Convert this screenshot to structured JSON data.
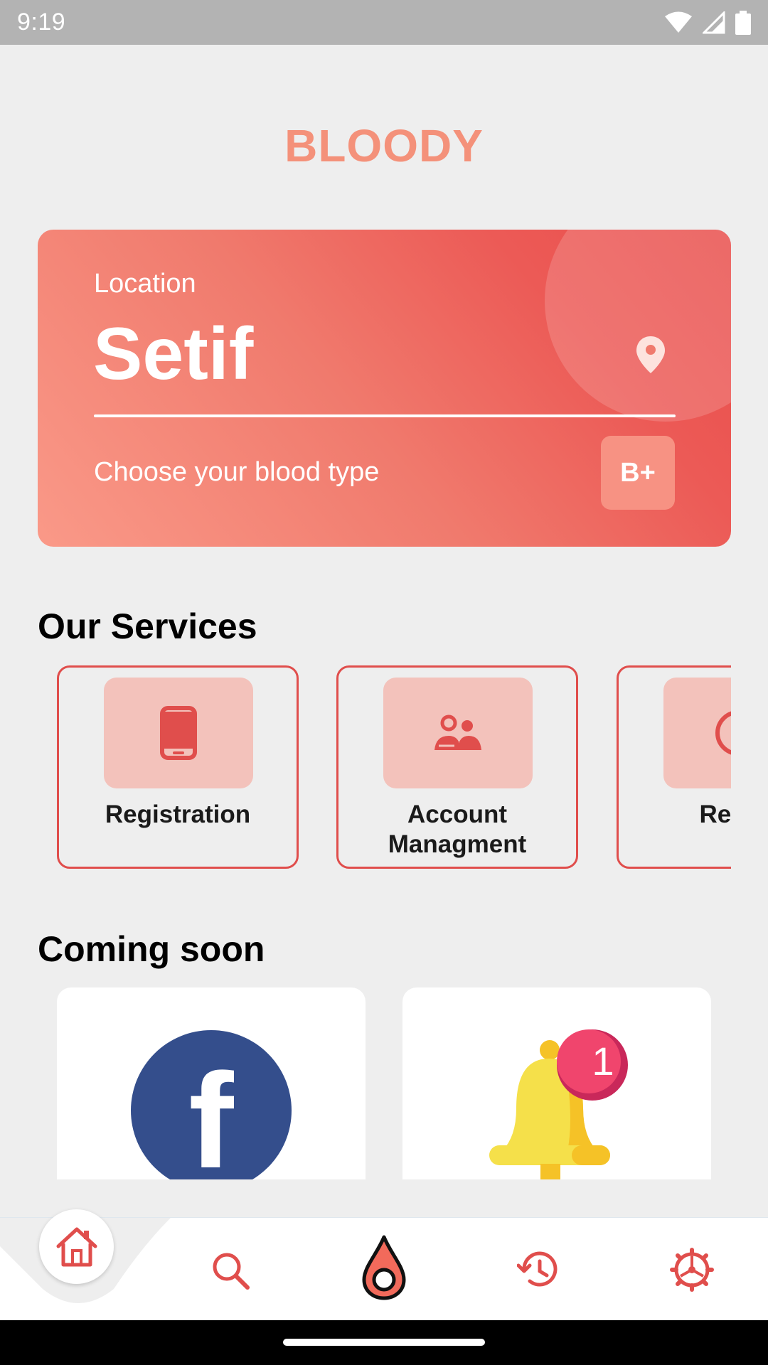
{
  "status_bar": {
    "time": "9:19"
  },
  "app": {
    "title": "BLOODY"
  },
  "location_card": {
    "label": "Location",
    "value": "Setif",
    "blood_type_prompt": "Choose your blood type",
    "blood_type": "B+"
  },
  "services": {
    "title": "Our Services",
    "items": [
      {
        "label": "Registration",
        "icon": "phone-icon"
      },
      {
        "label": "Account Managment",
        "icon": "users-icon"
      },
      {
        "label": "Rende",
        "icon": "clock-icon"
      }
    ]
  },
  "coming_soon": {
    "title": "Coming soon",
    "items": [
      {
        "icon": "facebook-icon",
        "letter": "f"
      },
      {
        "icon": "bell-notification-icon",
        "badge": "1"
      }
    ]
  },
  "bottom_nav": {
    "items": [
      {
        "icon": "home-icon",
        "active": true
      },
      {
        "icon": "search-icon"
      },
      {
        "icon": "blood-drop-icon"
      },
      {
        "icon": "history-icon"
      },
      {
        "icon": "settings-icon"
      }
    ]
  },
  "colors": {
    "accent": "#e04e4c",
    "title": "#f4917a",
    "card_gradient_start": "#fa9988",
    "card_gradient_end": "#e94d4b",
    "icon_box": "#f3c2bb",
    "facebook": "#344e8c",
    "bell": "#f5e04a",
    "badge": "#f0456d"
  }
}
